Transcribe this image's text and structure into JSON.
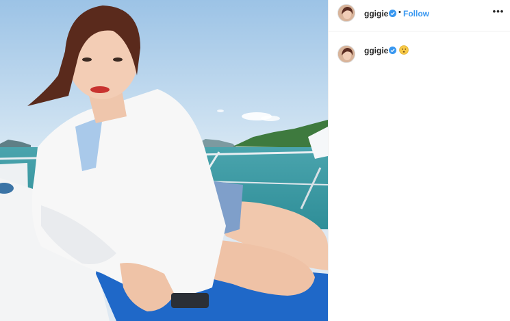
{
  "post": {
    "username": "ggigie",
    "follow_label": "Follow",
    "separator": "•",
    "more_label": "•••",
    "caption_emoji": "neutral-face-emoji"
  },
  "colors": {
    "follow": "#3897f0",
    "verified": "#3897f0",
    "divider": "#efefef"
  }
}
